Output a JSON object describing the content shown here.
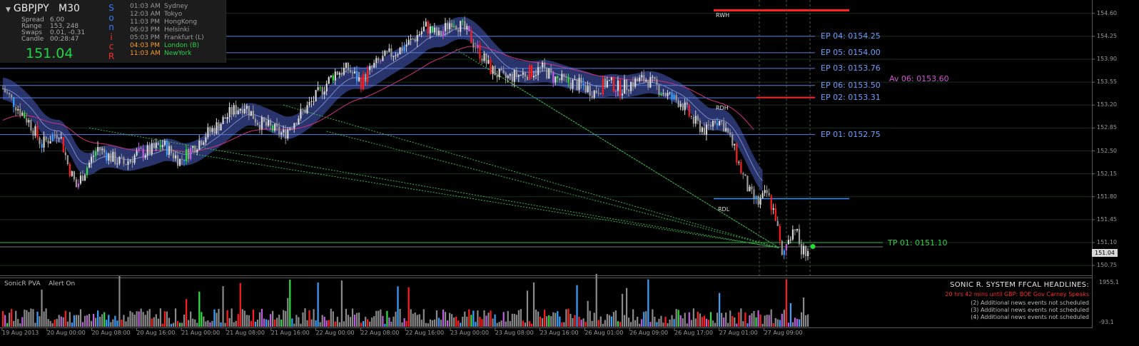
{
  "panel": {
    "symbol": "GBPJPY",
    "timeframe": "M30",
    "stats": [
      {
        "k": "Spread",
        "v": "6.00"
      },
      {
        "k": "Range",
        "v": "153, 248"
      },
      {
        "k": "Swaps",
        "v": "0.01, -0.31"
      },
      {
        "k": "Candle",
        "v": "00:28:47"
      }
    ],
    "price": "151.04",
    "sonic_letters": [
      {
        "ch": "S",
        "color": "#2f7bff"
      },
      {
        "ch": "o",
        "color": "#2f7bff"
      },
      {
        "ch": "n",
        "color": "#2f7bff"
      },
      {
        "ch": "i",
        "color": "#ff2a2a"
      },
      {
        "ch": "c",
        "color": "#ff2a2a"
      },
      {
        "ch": "R",
        "color": "#ff2a2a"
      }
    ],
    "sessions": [
      {
        "time": "01:03 AM",
        "name": "Sydney",
        "color": "#9a9a9a"
      },
      {
        "time": "12:03 AM",
        "name": "Tokyo",
        "color": "#9a9a9a"
      },
      {
        "time": "11:03 PM",
        "name": "HongKong",
        "color": "#9a9a9a"
      },
      {
        "time": "06:03 PM",
        "name": "Helsinki",
        "color": "#9a9a9a"
      },
      {
        "time": "05:03 PM",
        "name": "Frankfurt  (L)",
        "color": "#9a9a9a"
      },
      {
        "time": "04:03 PM",
        "name": "London  (B)",
        "color": "#2ed046",
        "tcolor": "#ff9a2a"
      },
      {
        "time": "11:03 AM",
        "name": "NewYork",
        "color": "#2ed046",
        "tcolor": "#ff9a2a"
      }
    ]
  },
  "levels": {
    "ep": [
      {
        "label": "EP 04:  0154.25",
        "price": 154.25
      },
      {
        "label": "EP 05:  0154.00",
        "price": 154.0
      },
      {
        "label": "EP 03:  0153.76",
        "price": 153.76
      },
      {
        "label": "EP 06:  0153.50",
        "price": 153.5
      },
      {
        "label": "EP 02:  0153.31",
        "price": 153.31
      },
      {
        "label": "EP 01:  0152.75",
        "price": 152.75
      }
    ],
    "av": {
      "label": "Av 06:  0153.60",
      "price": 153.6
    },
    "tp": {
      "label": "TP 01:  0151.10",
      "price": 151.1
    },
    "rwh": "RWH",
    "rdh": "RDH",
    "rdl": "RDL"
  },
  "indicator": {
    "name": "SonicR PVA",
    "alert": "Alert On",
    "max": "1955.1",
    "min": "-93.1"
  },
  "news": {
    "headline": "SONIC R. SYSTEM  FFCAL HEADLINES:",
    "alert": "20 hrs 42 mins until GBP: BOE Gov Carney Speaks",
    "items": [
      "(2)  Additional news events not scheduled",
      "(3)  Additional news events not scheduled",
      "(4)  Additional news events not scheduled"
    ]
  },
  "current_price_tag": "151.04",
  "colors": {
    "bull": "#d8d8d8",
    "bear": "#9a9a9a",
    "climax_up": "#ff1e1e",
    "climax_dn": "#ff1e1e",
    "vol_blue": "#3aa0ff",
    "vol_magenta": "#c060e0",
    "vol_green": "#30e040",
    "ema_band": "#2d3a78",
    "ma_magenta": "#d03080",
    "ep_line": "#5a7ee0",
    "tp_line": "#28c040",
    "fan": "#38b848"
  },
  "chart_data": {
    "type": "candlestick",
    "title": "GBPJPY M30",
    "ylim": [
      150.61,
      154.75
    ],
    "y_ticks": [
      "154.60",
      "154.25",
      "153.90",
      "153.55",
      "153.20",
      "152.85",
      "152.50",
      "152.15",
      "151.80",
      "151.45",
      "151.10",
      "150.75"
    ],
    "x_ticks": [
      "19 Aug 2013",
      "20 Aug 00:00",
      "20 Aug 08:00",
      "20 Aug 16:00",
      "21 Aug 00:00",
      "21 Aug 08:00",
      "21 Aug 16:00",
      "22 Aug 00:00",
      "22 Aug 08:00",
      "22 Aug 16:00",
      "23 Aug 00:00",
      "23 Aug 08:00",
      "23 Aug 16:00",
      "26 Aug 01:00",
      "26 Aug 09:00",
      "26 Aug 17:00",
      "27 Aug 01:00",
      "27 Aug 09:00"
    ],
    "price_path": [
      [
        0,
        153.45
      ],
      [
        6,
        153.2
      ],
      [
        12,
        152.95
      ],
      [
        18,
        152.6
      ],
      [
        22,
        152.7
      ],
      [
        26,
        152.8
      ],
      [
        30,
        152.3
      ],
      [
        34,
        151.95
      ],
      [
        38,
        152.2
      ],
      [
        44,
        152.55
      ],
      [
        50,
        152.4
      ],
      [
        56,
        152.3
      ],
      [
        62,
        152.45
      ],
      [
        68,
        152.5
      ],
      [
        74,
        152.6
      ],
      [
        82,
        152.35
      ],
      [
        88,
        152.55
      ],
      [
        94,
        152.75
      ],
      [
        100,
        152.9
      ],
      [
        106,
        153.1
      ],
      [
        112,
        153.2
      ],
      [
        118,
        152.95
      ],
      [
        124,
        152.85
      ],
      [
        130,
        152.75
      ],
      [
        136,
        153.0
      ],
      [
        142,
        153.2
      ],
      [
        148,
        153.45
      ],
      [
        154,
        153.7
      ],
      [
        160,
        153.75
      ],
      [
        166,
        153.55
      ],
      [
        172,
        153.8
      ],
      [
        178,
        153.95
      ],
      [
        184,
        154.05
      ],
      [
        190,
        154.2
      ],
      [
        196,
        154.4
      ],
      [
        202,
        154.25
      ],
      [
        208,
        154.5
      ],
      [
        214,
        154.35
      ],
      [
        220,
        154.05
      ],
      [
        226,
        153.75
      ],
      [
        232,
        153.6
      ],
      [
        238,
        153.65
      ],
      [
        244,
        153.7
      ],
      [
        250,
        153.75
      ],
      [
        256,
        153.6
      ],
      [
        262,
        153.55
      ],
      [
        268,
        153.5
      ],
      [
        274,
        153.4
      ],
      [
        280,
        153.55
      ],
      [
        286,
        153.45
      ],
      [
        292,
        153.55
      ],
      [
        298,
        153.6
      ],
      [
        304,
        153.45
      ],
      [
        310,
        153.3
      ],
      [
        314,
        153.25
      ],
      [
        320,
        152.95
      ],
      [
        326,
        152.8
      ],
      [
        330,
        153.0
      ],
      [
        334,
        152.9
      ],
      [
        338,
        152.6
      ],
      [
        342,
        152.2
      ],
      [
        346,
        151.85
      ],
      [
        350,
        151.7
      ],
      [
        354,
        151.85
      ],
      [
        358,
        151.5
      ],
      [
        361,
        150.85
      ],
      [
        364,
        151.2
      ],
      [
        367,
        151.35
      ],
      [
        370,
        150.95
      ],
      [
        373,
        151.0
      ]
    ],
    "volume_scale": [
      -93.1,
      1955.1
    ]
  }
}
